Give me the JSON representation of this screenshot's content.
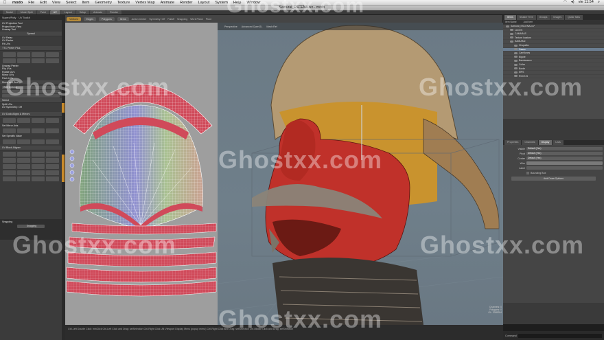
{
  "menubar": {
    "app": "modo",
    "items": [
      "File",
      "Edit",
      "View",
      "Select",
      "Item",
      "Geometry",
      "Texture",
      "Vertex Map",
      "Animate",
      "Render",
      "Layout",
      "System",
      "Help",
      "Window"
    ],
    "clock": "vie 11:54"
  },
  "window": {
    "title": "Samurai_ESCENA.lxo - modo"
  },
  "layout_tabs": [
    "Model",
    "Model Split",
    "Paint",
    "UV",
    "Layout",
    "Setup",
    "Animate",
    "Render"
  ],
  "layout_tab_active": 3,
  "left_panel": {
    "tabs": [
      "Superd/Polly",
      "UV Toolkit"
    ],
    "items_top": [
      "UV Projection Tool",
      "Project from View",
      "Unwrap Tool"
    ],
    "section1": "Spread",
    "items1": [
      "UV Relax",
      "UV Peeler",
      "Fit UVs"
    ],
    "section2": "TTC Peeler Plus",
    "items2": [
      "Unwrap Peeler",
      "Flip UVs",
      "Rotate UVs",
      "Mirror UVs",
      "Pack UVs"
    ],
    "section3": "Move and Sew",
    "items3": [
      "With Options"
    ],
    "section4": "Select",
    "items4": [
      "Split UVs",
      "UV Symmetry: Off"
    ],
    "section5": "UV Dock Aligns & Mirrors",
    "items5": [
      "Set Mirror Axis",
      "Set Specific Value"
    ],
    "section6": "UV Block Aligner",
    "bottom_label": "Snapping",
    "bottom_btn": "Snapping"
  },
  "toolbar": {
    "buttons": [
      "Vertices",
      "Edges",
      "Polygons",
      "Items"
    ],
    "active": 0,
    "labels": [
      "Action Center",
      "Symmetry: Off",
      "Falloff",
      "Snapping",
      "Work Plane",
      "Pivot"
    ]
  },
  "viewport_bar": [
    "Perspective",
    "Advanced OpenGL",
    "Mesh:Ref"
  ],
  "right_panel": {
    "tabs": [
      "Items",
      "Shader Tree",
      "Groups",
      "Images",
      "Quick Tabs"
    ],
    "active_tab": 0,
    "header_labels": [
      "Item Name",
      "Add Item"
    ],
    "tree_items": [
      {
        "label": "Samurai_ESCENA.lxo*",
        "sel": false
      },
      {
        "label": "LUCES",
        "sel": false
      },
      {
        "label": "CAMARAS",
        "sel": false
      },
      {
        "label": "Texture locators",
        "sel": false
      },
      {
        "label": "SAMURAI",
        "sel": false
      },
      {
        "label": "Chupalbo",
        "sel": false
      },
      {
        "label": "Casco",
        "sel": true
      },
      {
        "label": "Carrillones",
        "sel": false
      },
      {
        "label": "Bigote",
        "sel": false
      },
      {
        "label": "Bandacasco",
        "sel": false
      },
      {
        "label": "Collar",
        "sel": false
      },
      {
        "label": "Borde",
        "sel": false
      },
      {
        "label": "MPS",
        "sel": false
      },
      {
        "label": "ROCK B",
        "sel": false
      }
    ],
    "props_tabs": [
      "Properties",
      "Channels",
      "Display",
      "Lists"
    ],
    "props_active": 2,
    "props_rows": [
      {
        "label": "Visible",
        "value": "Default (Yes)"
      },
      {
        "label": "Pivot",
        "value": "Default (Yes)"
      },
      {
        "label": "Center",
        "value": "Default (Yes)"
      },
      {
        "label": "Wire",
        "value": ""
      },
      {
        "label": "Label",
        "value": ""
      }
    ],
    "bounding_box": "Bounding Box",
    "add_button": "Add Draw Options"
  },
  "status": {
    "hint": "Ctrl-Left Double Click: minClick  Ctrl-Left Click and Drag: setSelection  Ctrl-Right Click: Alt Viewport Display Menu (popup menu)  Ctrl-Right Click and Drag: setSelection  Ctrl-Middle Click and Drag: setSelection"
  },
  "command": {
    "label": "Command"
  },
  "viewport_info": [
    "Channels: 0",
    "Polygons: 0",
    "GL: 3385284"
  ],
  "watermark": "Ghostxx.com"
}
